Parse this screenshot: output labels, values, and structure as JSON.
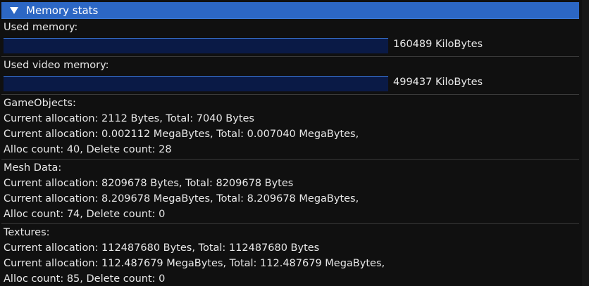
{
  "header": {
    "title": "Memory stats",
    "collapse_icon": "triangle-down-icon"
  },
  "used_memory": {
    "label": "Used memory:",
    "value": "160489 KiloBytes",
    "fill_fraction": 0
  },
  "used_video_memory": {
    "label": "Used video memory:",
    "value": "499437 KiloBytes",
    "fill_fraction": 0
  },
  "sections": [
    {
      "title": "GameObjects:",
      "bytes_line": "Current allocation: 2112 Bytes, Total: 7040 Bytes",
      "mb_line": "Current allocation: 0.002112 MegaBytes, Total: 0.007040 MegaBytes,",
      "count_line": "Alloc count: 40, Delete count: 28"
    },
    {
      "title": "Mesh Data:",
      "bytes_line": "Current allocation: 8209678 Bytes, Total: 8209678 Bytes",
      "mb_line": "Current allocation: 8.209678 MegaBytes, Total: 8.209678 MegaBytes,",
      "count_line": "Alloc count: 74, Delete count: 0"
    },
    {
      "title": "Textures:",
      "bytes_line": "Current allocation: 112487680 Bytes, Total: 112487680 Bytes",
      "mb_line": "Current allocation: 112.487679 MegaBytes, Total: 112.487679 MegaBytes,",
      "count_line": "Alloc count: 85, Delete count: 0"
    }
  ],
  "colors": {
    "header_bg": "#2c67c4",
    "panel_bg": "#101010",
    "bar_bg": "#0a1a46",
    "bar_border": "#3a74d0",
    "text": "#e8e8e8"
  }
}
